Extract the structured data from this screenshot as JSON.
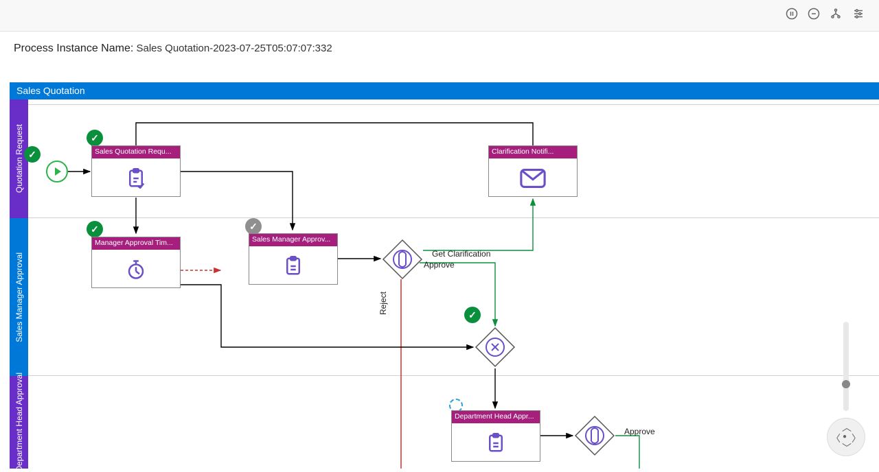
{
  "header": {
    "label": "Process Instance Name:",
    "value": "Sales Quotation-2023-07-25T05:07:07:332"
  },
  "pool": {
    "title": "Sales Quotation"
  },
  "lanes": [
    {
      "name": "Quotation Request",
      "color": "#6a2ec8"
    },
    {
      "name": "Sales Manager Approval",
      "color": "#0078d7"
    },
    {
      "name": "Department Head Approval",
      "color": "#6a2ec8"
    }
  ],
  "tasks": {
    "sales_quotation_request": {
      "label": "Sales Quotation Requ...",
      "icon": "form"
    },
    "clarification_notification": {
      "label": "Clarification Notifi...",
      "icon": "mail"
    },
    "manager_approval_timer": {
      "label": "Manager Approval Tim...",
      "icon": "timer"
    },
    "sales_manager_approval": {
      "label": "Sales Manager Approv...",
      "icon": "form"
    },
    "department_head_approval": {
      "label": "Department Head Appr...",
      "icon": "form"
    }
  },
  "gateway_labels": {
    "get_clarification": "Get Clarification",
    "approve": "Approve",
    "reject": "Reject",
    "approve2": "Approve"
  },
  "status_marks": {
    "check": "✓"
  }
}
